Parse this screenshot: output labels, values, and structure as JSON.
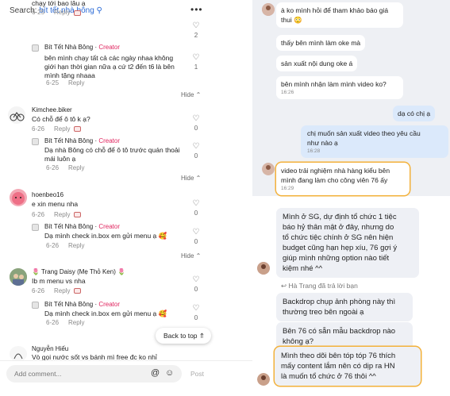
{
  "search": {
    "prefix": "Search:",
    "keyword": "bít tết nhà bông"
  },
  "creator_tag": "Creator",
  "hide_label": "Hide",
  "reply_label": "Reply",
  "comments": [
    {
      "id": "c0",
      "username": "",
      "text": "chạy tới bao lâu ạ",
      "date": "6-25",
      "likes": "2"
    },
    {
      "id": "c0r",
      "username": "Bít Tết Nhà Bông",
      "text": "bên mình chạy tất cả các ngày nhaa không\ngiới hạn thời gian nữa ạ cứ t2 đến t6 là bên\nmình tặng nhaaa",
      "date": "6-25",
      "likes": "1"
    },
    {
      "id": "c1",
      "username": "Kimchee.biker",
      "text": "Có chỗ để ô tô k ạ?",
      "date": "6-26",
      "likes": "0"
    },
    {
      "id": "c1r",
      "username": "Bít Tết Nhà Bông",
      "text": "Dạ nhà Bông có chỗ để ô tô trước quán thoải\nmái luôn ạ",
      "date": "6-26",
      "likes": "0"
    },
    {
      "id": "c2",
      "username": "hoenbeo16",
      "text": "e xin menu nha",
      "date": "6-26",
      "likes": "0"
    },
    {
      "id": "c2r",
      "username": "Bít Tết Nhà Bông",
      "text": "Dạ mình check in.box em gửi menu ạ 🥰",
      "date": "6-26",
      "likes": "0"
    },
    {
      "id": "c3",
      "username": "🌷 Trang Daisy (Mẹ Thỏ Ken) 🌷",
      "text": "Ib m menu vs nha",
      "date": "6-26",
      "likes": "0"
    },
    {
      "id": "c3r",
      "username": "Bít Tết Nhà Bông",
      "text": "Dạ mình check in.box em gửi menu ạ 🥰",
      "date": "6-26",
      "likes": "0"
    },
    {
      "id": "c4",
      "username": "Nguyễn Hiếu",
      "text": "Vò gọi nước sốt vs bánh mì free đc ko nhỉ",
      "date": "",
      "likes": ""
    }
  ],
  "back_to_top": "Back to top",
  "composer": {
    "placeholder": "Add comment...",
    "post": "Post"
  },
  "chat_top": [
    {
      "id": "m1",
      "dir": "in",
      "text": "à ko mình hỏi để tham khảo báo giá\nthui 😳",
      "time": ""
    },
    {
      "id": "m2",
      "dir": "in",
      "text": "thấy bên mình làm oke mà",
      "time": ""
    },
    {
      "id": "m3",
      "dir": "in",
      "text": "sản xuất nội dung oke á",
      "time": ""
    },
    {
      "id": "m4",
      "dir": "in",
      "text": "bên mình nhận làm mình video ko?",
      "time": "16:26"
    },
    {
      "id": "m5",
      "dir": "out",
      "text": "dạ có chị ạ",
      "time": ""
    },
    {
      "id": "m6",
      "dir": "out",
      "text": "chị muốn sản xuất video theo yêu cầu\nnhư nào ạ",
      "time": "16:28"
    },
    {
      "id": "m7",
      "dir": "in",
      "text": "video trải nghiệm nhà hàng kiểu bên\nmình đang làm cho công viên 76 ấy",
      "time": "16:29"
    }
  ],
  "chat_bottom": [
    {
      "id": "b1",
      "text": "Mình ở SG, dự định tổ chức 1 tiệc\nbáo hỷ thân mật ở đây, nhưng do\ntổ chức tiệc chính ở SG nên hiện\nbudget cũng hạn hẹp xíu, 76 gợi ý\ngiúp mình những option nào tiết\nkiệm nhé ^^"
    },
    {
      "id": "b2",
      "text": "Backdrop chụp ảnh phòng này thì\nthường treo bên ngoài ạ"
    },
    {
      "id": "b3",
      "text": "Bên 76 có sẵn mẫu backdrop nào\nkhông ạ?"
    },
    {
      "id": "b4",
      "text": "Mình theo dõi bên tóp tóp 76 thích\nmấy content lắm nên có dịp ra HN\nlà muốn tổ chức ở 76 thôi ^^"
    }
  ],
  "reply_notice": "Hà Trang đã trả lời bạn",
  "colors": {
    "creator": "#e0245e",
    "highlight": "#f3b13a",
    "out_bubble": "#dbe9fb",
    "chat_bg": "#eef0f4"
  }
}
